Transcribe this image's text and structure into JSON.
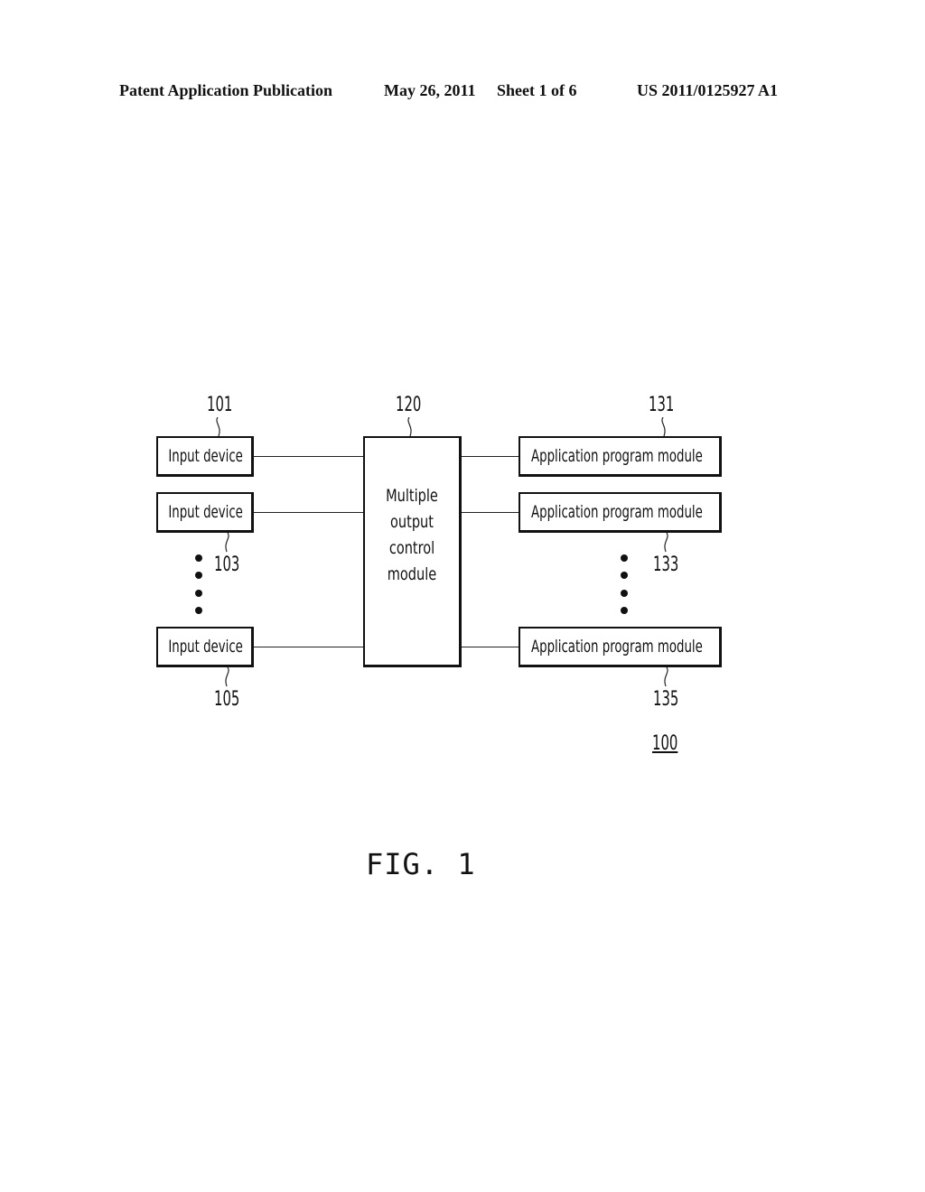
{
  "header": {
    "publication": "Patent Application Publication",
    "date": "May 26, 2011",
    "sheet": "Sheet 1 of 6",
    "number": "US 2011/0125927 A1"
  },
  "diagram": {
    "system_ref": "100",
    "input_devices": [
      {
        "label": "Input device",
        "ref": "101"
      },
      {
        "label": "Input device",
        "ref": "103"
      },
      {
        "label": "Input device",
        "ref": "105"
      }
    ],
    "control_module": {
      "label": "Multiple\noutput\ncontrol\nmodule",
      "ref": "120"
    },
    "app_modules": [
      {
        "label": "Application program module",
        "ref": "131"
      },
      {
        "label": "Application program module",
        "ref": "133"
      },
      {
        "label": "Application program module",
        "ref": "135"
      }
    ]
  },
  "figure_caption": "FIG. 1"
}
